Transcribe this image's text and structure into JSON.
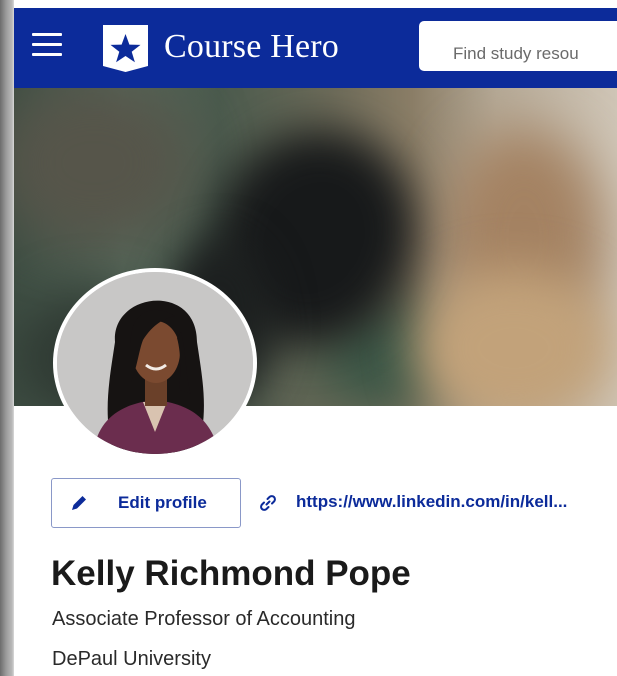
{
  "header": {
    "brand_name": "Course Hero",
    "search_placeholder": "Find study resou",
    "colors": {
      "bar": "#0c2b9a",
      "text": "#ffffff"
    }
  },
  "profile": {
    "edit_label": "Edit profile",
    "linkedin_url": "https://www.linkedin.com/in/kell...",
    "name": "Kelly Richmond Pope",
    "title": "Associate Professor of Accounting",
    "organization": "DePaul University"
  },
  "icons": [
    "menu-icon",
    "star-shield-logo-icon",
    "pencil-icon",
    "link-icon"
  ],
  "colors": {
    "accent": "#0c2b9a",
    "button_border": "#8a98c8",
    "name_text": "#1a1a1a"
  }
}
